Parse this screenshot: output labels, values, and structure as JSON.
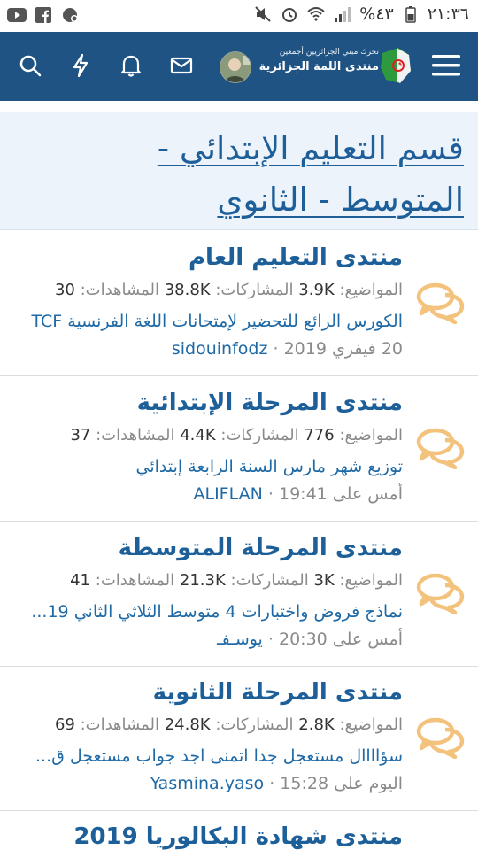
{
  "status_bar": {
    "time": "٢١:٣٦",
    "battery": "%٤٣"
  },
  "header": {
    "logo_line1": "تحرك مبني الجزائريين أجمعين",
    "logo_line2": "منتدى اللمة الجزائرية",
    "icons": [
      "search-icon",
      "bolt-icon",
      "bell-icon",
      "mail-icon",
      "avatar",
      "menu-icon"
    ]
  },
  "page": {
    "title": "قسم التعليم الإبتدائي - المتوسط - الثانوي"
  },
  "forums": [
    {
      "name": "منتدى التعليم العام",
      "topics_label": "المواضيع:",
      "topics": "3.9K",
      "posts_label": "المشاركات:",
      "posts": "38.8K",
      "views_label": "المشاهدات:",
      "views": "30",
      "last_title": "الكورس الرائع للتحضير لإمتحانات اللغة الفرنسية TCF",
      "last_date": "20 فيفري 2019",
      "last_user": "sidouinfodz"
    },
    {
      "name": "منتدى المرحلة الإبتدائية",
      "topics_label": "المواضيع:",
      "topics": "776",
      "posts_label": "المشاركات:",
      "posts": "4.4K",
      "views_label": "المشاهدات:",
      "views": "37",
      "last_title": "توزيع شهر مارس السنة الرابعة إبتدائي",
      "last_date": "أمس على 19:41",
      "last_user": "ALIFLAN"
    },
    {
      "name": "منتدى المرحلة المتوسطة",
      "topics_label": "المواضيع:",
      "topics": "3K",
      "posts_label": "المشاركات:",
      "posts": "21.3K",
      "views_label": "المشاهدات:",
      "views": "41",
      "last_title": "نماذج فروض واختبارات 4 متوسط الثلاثي الثاني 19...",
      "last_date": "أمس على 20:30",
      "last_user": "يوسـفـ"
    },
    {
      "name": "منتدى المرحلة الثانوية",
      "topics_label": "المواضيع:",
      "topics": "2.8K",
      "posts_label": "المشاركات:",
      "posts": "24.8K",
      "views_label": "المشاهدات:",
      "views": "69",
      "last_title": "سؤاااال مستعجل جدا اتمنى اجد جواب مستعجل ق...",
      "last_date": "اليوم على 15:28",
      "last_user": "Yasmina.yaso"
    },
    {
      "name": "منتدى شهادة البكالوريا 2019"
    }
  ],
  "colors": {
    "header_bg": "#1e5384",
    "title_bg": "#ecf3fa",
    "link": "#1d5f98",
    "bubble": "#f3c27d"
  }
}
